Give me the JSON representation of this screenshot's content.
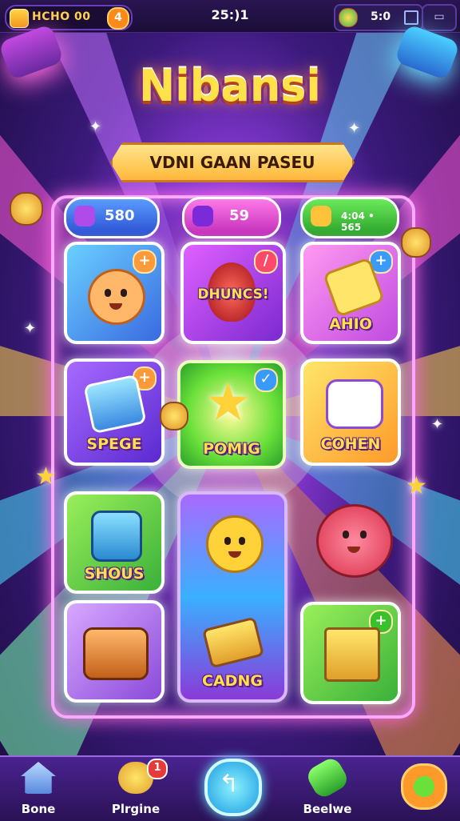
{
  "top_bar": {
    "coins_label": "HCHO 00",
    "coins_badge": "4",
    "timer": "25:)1",
    "energy_value": "5:0"
  },
  "logo_text": "Nibansi",
  "banner_text": "VDNI GAAN PASEU",
  "stats": [
    {
      "value": "580",
      "icon": "potion-icon",
      "color": "#3a6ee8"
    },
    {
      "value": "59",
      "icon": "gem-icon",
      "color": "#e04ad8"
    },
    {
      "value": "4:04 • 565",
      "icon": "gold-bar-icon",
      "color": "#3cc23a"
    }
  ],
  "tiles": [
    {
      "label": "",
      "icon": "hero-face-icon"
    },
    {
      "label": "DHUNCS!",
      "icon": "ruby-icon"
    },
    {
      "label": "AHIO",
      "icon": "heart-key-icon"
    },
    {
      "label": "SPEGE",
      "icon": "crystal-card-icon"
    },
    {
      "label": "POMIG",
      "icon": "gold-star-icon"
    },
    {
      "label": "COHEN",
      "icon": "candy-roll-icon"
    },
    {
      "label": "SHOUS",
      "icon": "dice-icon"
    },
    {
      "label": "",
      "icon": "green-hat-creature-icon"
    },
    {
      "label": "",
      "icon": "pink-bunny-icon"
    },
    {
      "label": "",
      "icon": "animal-basket-icon"
    },
    {
      "label": "CADNG",
      "icon": "golden-card-icon"
    },
    {
      "label": "",
      "icon": "gift-box-icon"
    }
  ],
  "bottom_nav": [
    {
      "label": "Bone",
      "icon": "home-icon"
    },
    {
      "label": "Plrgine",
      "icon": "chat-bubble-icon",
      "badge": "1"
    },
    {
      "label": "",
      "icon": "back-arrow-icon"
    },
    {
      "label": "Beelwe",
      "icon": "wrench-icon"
    },
    {
      "label": "",
      "icon": "settings-gear-icon"
    }
  ]
}
